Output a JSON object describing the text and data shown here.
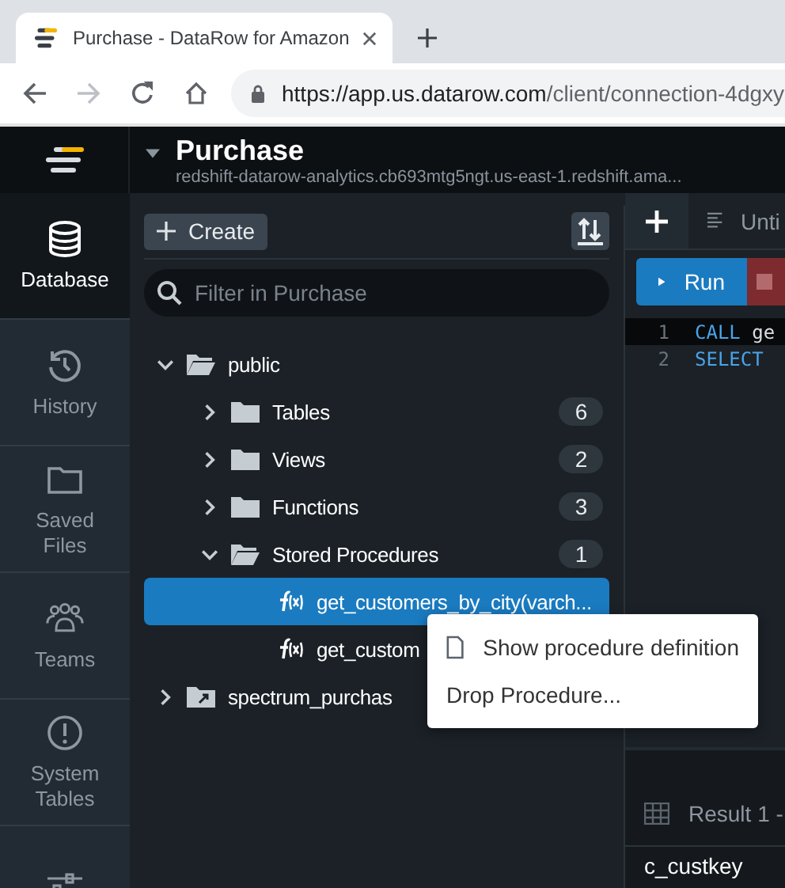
{
  "browser": {
    "tab_title": "Purchase - DataRow for Amazon",
    "url_host": "https://app.us.datarow.com",
    "url_path": "/client/connection-4dgxy"
  },
  "header": {
    "title": "Purchase",
    "subtitle": "redshift-datarow-analytics.cb693mtg5ngt.us-east-1.redshift.ama..."
  },
  "nav": [
    {
      "label": "Database",
      "selected": true
    },
    {
      "label": "History",
      "selected": false
    },
    {
      "label": "Saved Files",
      "selected": false
    },
    {
      "label": "Teams",
      "selected": false
    },
    {
      "label": "System Tables",
      "selected": false
    },
    {
      "selected": false
    }
  ],
  "toolbar": {
    "create": "Create"
  },
  "filter": {
    "placeholder": "Filter in Purchase"
  },
  "tree": [
    {
      "label": "public",
      "kind": "folder",
      "expanded": true,
      "children": [
        {
          "label": "Tables",
          "kind": "folder",
          "count": "6",
          "expanded": false
        },
        {
          "label": "Views",
          "kind": "folder",
          "count": "2",
          "expanded": false
        },
        {
          "label": "Functions",
          "kind": "folder",
          "count": "3",
          "expanded": false
        },
        {
          "label": "Stored Procedures",
          "kind": "folder",
          "count": "1",
          "expanded": true,
          "children": [
            {
              "label": "get_customers_by_city(varch...",
              "kind": "procedure",
              "selected": true
            },
            {
              "label": "get_custom",
              "kind": "procedure",
              "selected": false
            }
          ]
        }
      ]
    },
    {
      "label": "spectrum_purchas",
      "kind": "external",
      "expanded": false
    }
  ],
  "context_menu": [
    {
      "label": "Show procedure definition",
      "kind": "document"
    },
    {
      "label": "Drop Procedure...",
      "kind": "plain"
    }
  ],
  "editor": {
    "tab": "Unti",
    "run": "Run",
    "lines": [
      {
        "number": "1",
        "keyword": "CALL",
        "rest": "ge",
        "current": true
      },
      {
        "number": "2",
        "keyword": "SELECT",
        "current": false
      }
    ],
    "results_tab": "Result 1 -",
    "column": "c_custkey"
  }
}
